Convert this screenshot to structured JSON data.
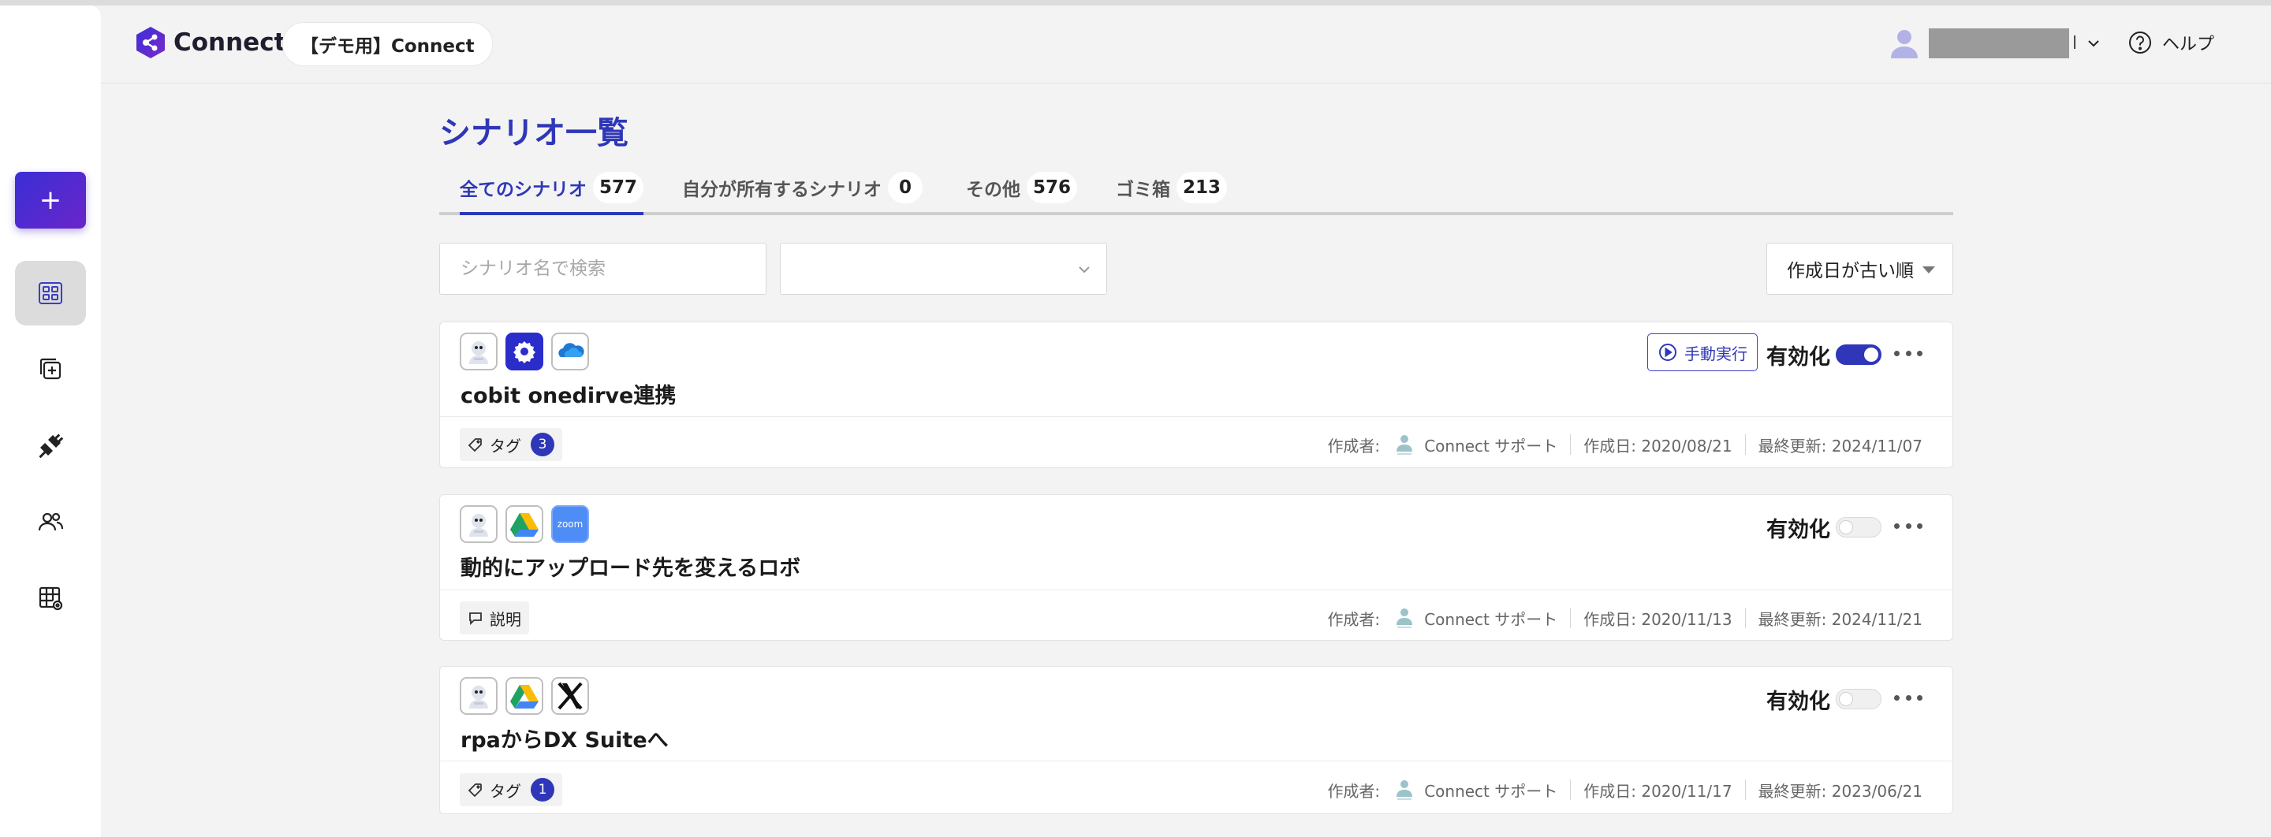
{
  "header": {
    "app_name": "Connect",
    "workspace": "【デモ用】Connect",
    "user_name_tail": "l",
    "help_label": "ヘルプ"
  },
  "page": {
    "title": "シナリオ一覧"
  },
  "tabs": [
    {
      "label": "全てのシナリオ",
      "count": "577",
      "active": true
    },
    {
      "label": "自分が所有するシナリオ",
      "count": "0",
      "active": false
    },
    {
      "label": "その他",
      "count": "576",
      "active": false
    },
    {
      "label": "ゴミ箱",
      "count": "213",
      "active": false
    }
  ],
  "filters": {
    "search_placeholder": "シナリオ名で検索",
    "filter_value": "",
    "sort_label": "作成日が古い順"
  },
  "sidebar": {
    "add_label": "+",
    "items": [
      "scenario-list-icon",
      "copy-add-icon",
      "connector-plug-icon",
      "users-icon",
      "table-settings-icon"
    ]
  },
  "scenarios": [
    {
      "apps": [
        "robot-icon",
        "gear-icon",
        "onedrive-icon"
      ],
      "title": "cobit onedirve連携",
      "chip_label": "タグ",
      "chip_count": "3",
      "show_run": true,
      "run_label": "手動実行",
      "enabled_label": "有効化",
      "enabled": true,
      "creator_label": "作成者:",
      "creator": "Connect サポート",
      "created": "作成日: 2020/08/21",
      "updated": "最終更新: 2024/11/07"
    },
    {
      "apps": [
        "robot-icon",
        "google-drive-icon",
        "zoom-icon"
      ],
      "title": "動的にアップロード先を変えるロボ",
      "chip_label": "説明",
      "chip_count": "",
      "show_run": false,
      "run_label": "",
      "enabled_label": "有効化",
      "enabled": false,
      "creator_label": "作成者:",
      "creator": "Connect サポート",
      "created": "作成日: 2020/11/13",
      "updated": "最終更新: 2024/11/21"
    },
    {
      "apps": [
        "robot-icon",
        "google-drive-icon",
        "x-icon"
      ],
      "title": "rpaからDX Suiteへ",
      "chip_label": "タグ",
      "chip_count": "1",
      "show_run": false,
      "run_label": "",
      "enabled_label": "有効化",
      "enabled": false,
      "creator_label": "作成者:",
      "creator": "Connect サポート",
      "created": "作成日: 2020/11/17",
      "updated": "最終更新: 2023/06/21"
    }
  ],
  "zoom_text": "zoom",
  "colors": {
    "accent": "#2f37b8",
    "add_button_start": "#3a2fd6",
    "add_button_end": "#6a25c9"
  }
}
